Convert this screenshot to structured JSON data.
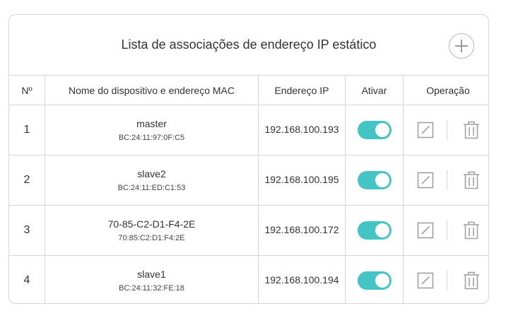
{
  "header": {
    "title": "Lista de associações de endereço IP estático"
  },
  "table": {
    "columns": {
      "no": "Nº",
      "name": "Nome do dispositivo e endereço MAC",
      "ip": "Endereço IP",
      "enable": "Ativar",
      "operation": "Operação"
    },
    "rows": [
      {
        "no": "1",
        "name": "master",
        "mac": "BC:24:11:97:0F:C5",
        "ip": "192.168.100.193",
        "enabled": true
      },
      {
        "no": "2",
        "name": "slave2",
        "mac": "BC:24:11:ED:C1:53",
        "ip": "192.168.100.195",
        "enabled": true
      },
      {
        "no": "3",
        "name": "70-85-C2-D1-F4-2E",
        "mac": "70:85:C2:D1:F4:2E",
        "ip": "192.168.100.172",
        "enabled": true
      },
      {
        "no": "4",
        "name": "slave1",
        "mac": "BC:24:11:32:FE:18",
        "ip": "192.168.100.194",
        "enabled": true
      }
    ]
  },
  "icons": {
    "add": "plus-icon",
    "edit": "edit-icon",
    "delete": "trash-icon"
  },
  "colors": {
    "toggle_on": "#44c4c4",
    "border": "#d6d6d6",
    "icon": "#a0a0a0"
  }
}
